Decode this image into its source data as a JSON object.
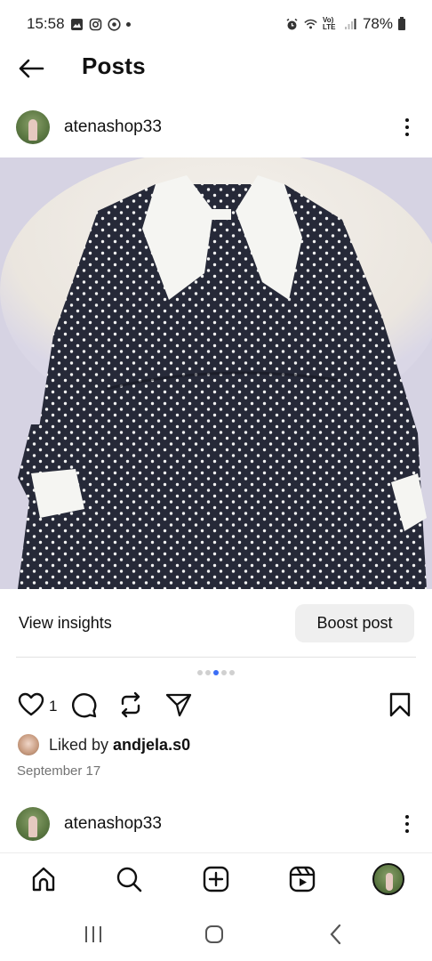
{
  "status_bar": {
    "time": "15:58",
    "battery": "78%",
    "network": "Vo) LTE"
  },
  "header": {
    "title": "Posts",
    "back_icon": "arrow-left-icon"
  },
  "post": {
    "username": "atenashop33",
    "image_description_icon": "photo",
    "view_insights_label": "View insights",
    "boost_label": "Boost post",
    "carousel": {
      "total": 5,
      "active_index": 2
    },
    "like_count": "1",
    "liked_by_prefix": "Liked by ",
    "liked_by_user": "andjela.s0",
    "date": "September 17"
  },
  "next_post": {
    "username": "atenashop33"
  },
  "bottom_nav": {
    "items": [
      "home-icon",
      "search-icon",
      "create-icon",
      "reels-icon",
      "profile-avatar"
    ]
  },
  "system_nav": {
    "items": [
      "recents-icon",
      "home-icon",
      "back-icon"
    ]
  },
  "colors": {
    "accent": "#3b6ef6",
    "muted_text": "#737373",
    "button_bg": "#efefef"
  }
}
